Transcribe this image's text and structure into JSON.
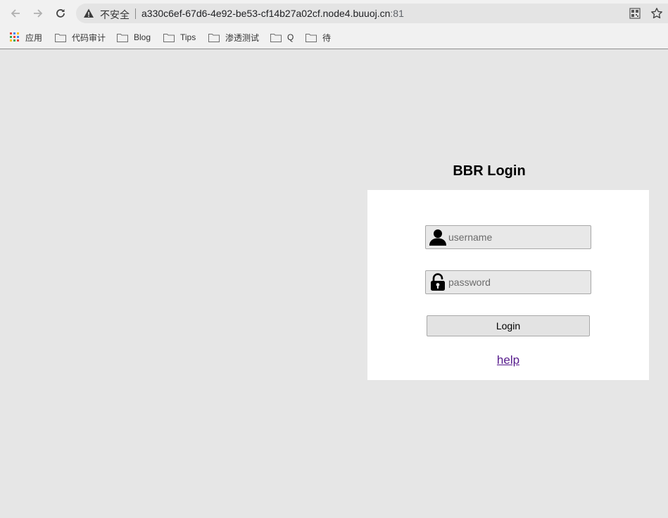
{
  "browser": {
    "security_label": "不安全",
    "url_host": "a330c6ef-67d6-4e92-be53-cf14b27a02cf.node4.buuoj.cn",
    "url_port": ":81",
    "bookmarks": [
      {
        "label": "应用",
        "icon": "apps-grid-icon"
      },
      {
        "label": "代码审计",
        "icon": "folder-icon"
      },
      {
        "label": "Blog",
        "icon": "folder-icon"
      },
      {
        "label": "Tips",
        "icon": "folder-icon"
      },
      {
        "label": "渗透测试",
        "icon": "folder-icon"
      },
      {
        "label": "Q",
        "icon": "folder-icon"
      },
      {
        "label": "待",
        "icon": "folder-icon"
      }
    ]
  },
  "login": {
    "title": "BBR Login",
    "username_placeholder": "username",
    "password_placeholder": "password",
    "submit_label": "Login",
    "help_label": "help"
  },
  "colors": {
    "page_background": "#e6e6e6",
    "card_background": "#ffffff",
    "visited_link": "#551a8b"
  }
}
